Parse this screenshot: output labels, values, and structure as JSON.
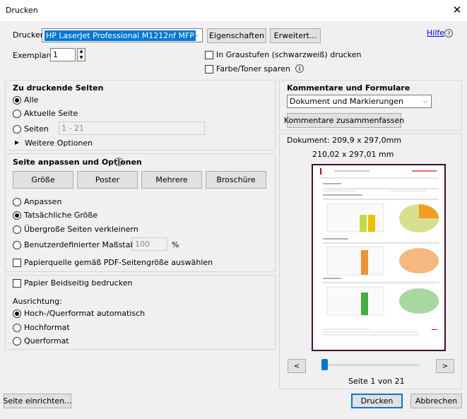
{
  "window": {
    "title": "Drucken"
  },
  "printer": {
    "label": "Drucker:",
    "selected": "HP LaserJet Professional M1212nf MFP",
    "properties_button": "Eigenschaften",
    "advanced_button": "Erweitert...",
    "help_link": "Hilfe"
  },
  "copies": {
    "label": "Exemplare:",
    "value": "1",
    "grayscale_label": "In Graustufen (schwarzweiß) drucken",
    "save_toner_label": "Farbe/Toner sparen"
  },
  "pages": {
    "heading": "Zu druckende Seiten",
    "all": "Alle",
    "current": "Aktuelle Seite",
    "pages": "Seiten",
    "range_placeholder": "1 - 21",
    "more_options": "Weitere Optionen"
  },
  "sizing": {
    "heading": "Seite anpassen und Optionen",
    "size_button": "Größe",
    "poster_button": "Poster",
    "multiple_button": "Mehrere",
    "booklet_button": "Broschüre",
    "fit": "Anpassen",
    "actual": "Tatsächliche Größe",
    "shrink": "Übergroße Seiten verkleinern",
    "custom": "Benutzerdefinierter Maßstab:",
    "custom_value": "100",
    "percent": "%",
    "paper_source": "Papierquelle gemäß PDF-Seitengröße auswählen"
  },
  "duplex": {
    "both_sides": "Papier Beidseitig bedrucken",
    "orientation_label": "Ausrichtung:",
    "auto": "Hoch-/Querformat automatisch",
    "portrait": "Hochformat",
    "landscape": "Querformat"
  },
  "comments": {
    "heading": "Kommentare und Formulare",
    "selected": "Dokument und Markierungen",
    "summarize_button": "Kommentare zusammenfassen"
  },
  "preview": {
    "document_size": "Dokument: 209,9 x 297,0mm",
    "page_size": "210,02 x 297,01 mm",
    "page_indicator": "Seite 1 von 21",
    "prev": "<",
    "next": ">"
  },
  "footer": {
    "page_setup_button": "Seite einrichten...",
    "print_button": "Drucken",
    "cancel_button": "Abbrechen"
  },
  "colors": {
    "accent": "#0078d7",
    "preview_border": "#3a0f33"
  }
}
